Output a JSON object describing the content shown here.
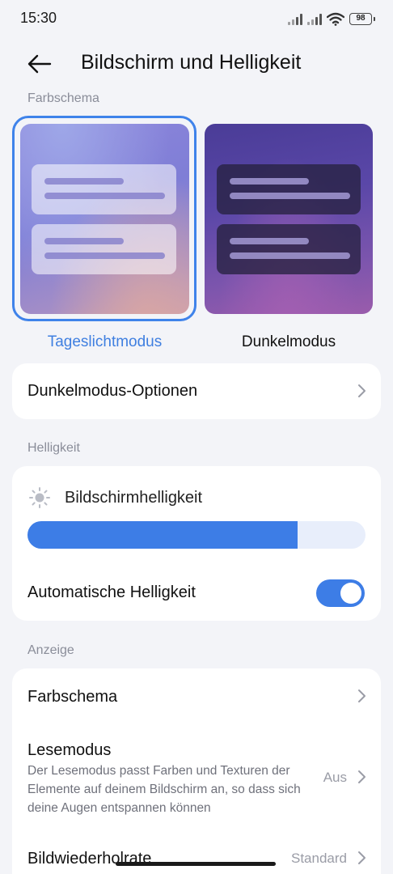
{
  "status_bar": {
    "time": "15:30",
    "battery": "98",
    "icons": [
      "signal-icon",
      "signal-icon",
      "wifi-icon",
      "battery-icon"
    ]
  },
  "header": {
    "back_icon": "arrow-left-icon",
    "title": "Bildschirm und Helligkeit"
  },
  "color_scheme_section": {
    "label": "Farbschema",
    "options": [
      {
        "label": "Tageslichtmodus",
        "selected": true
      },
      {
        "label": "Dunkelmodus",
        "selected": false
      }
    ]
  },
  "dark_mode_options": {
    "label": "Dunkelmodus-Optionen"
  },
  "brightness_section": {
    "label": "Helligkeit",
    "brightness_label": "Bildschirmhelligkeit",
    "brightness_icon": "sun-icon",
    "brightness_level": 0.8,
    "auto_brightness_label": "Automatische Helligkeit",
    "auto_brightness_enabled": true
  },
  "display_section": {
    "label": "Anzeige",
    "items": [
      {
        "title": "Farbschema"
      },
      {
        "title": "Lesemodus",
        "description": "Der Lesemodus passt Farben und Texturen der Elemente auf deinem Bildschirm an, so dass sich deine Augen entspannen können",
        "value": "Aus"
      },
      {
        "title": "Bildwiederholrate",
        "value": "Standard"
      }
    ]
  },
  "colors": {
    "accent": "#3d7de6",
    "background": "#f3f4f8",
    "card": "#ffffff"
  }
}
